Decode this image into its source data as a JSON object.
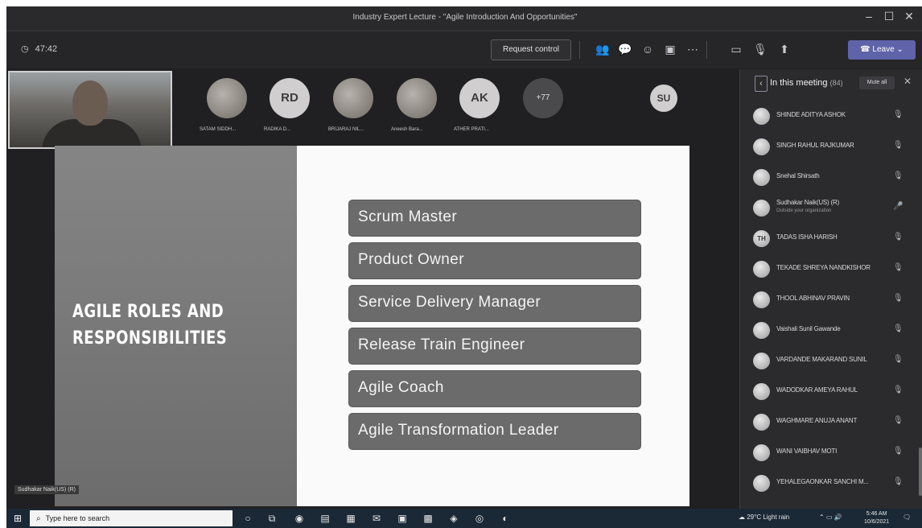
{
  "window": {
    "title": "Industry Expert Lecture - \"Agile Introduction And Opportunities\""
  },
  "toolbar": {
    "timer": "47:42",
    "request_control": "Request control",
    "leave": "Leave"
  },
  "video_strip": {
    "avatars": [
      {
        "initials": "",
        "name": "SATAM SIDDH..."
      },
      {
        "initials": "RD",
        "name": "RADIKA D..."
      },
      {
        "initials": "",
        "name": "BRIJARAJ NIL..."
      },
      {
        "initials": "",
        "name": "Aneesh Bara..."
      },
      {
        "initials": "AK",
        "name": "ATHER PRATI..."
      },
      {
        "initials": "+77",
        "name": ""
      },
      {
        "initials": "SU",
        "name": ""
      }
    ]
  },
  "slide": {
    "title_line1": "AGILE ROLES AND",
    "title_line2": "RESPONSIBILITIES",
    "roles": [
      "Scrum Master",
      "Product Owner",
      "Service Delivery Manager",
      "Release Train Engineer",
      "Agile Coach",
      "Agile Transformation Leader"
    ],
    "presenter_label": "Sudhakar Naik(US) (R)"
  },
  "panel": {
    "title": "In this meeting",
    "count": "(84)",
    "mute_all": "Mute all",
    "participants": [
      {
        "name": "SHINDE ADITYA ASHOK",
        "initials": "",
        "sub": ""
      },
      {
        "name": "SINGH RAHUL RAJKUMAR",
        "initials": "",
        "sub": ""
      },
      {
        "name": "Snehal Shirsath",
        "initials": "",
        "sub": ""
      },
      {
        "name": "Sudhakar Naik(US) (R)",
        "initials": "",
        "sub": "Outside your organization"
      },
      {
        "name": "TADAS ISHA HARISH",
        "initials": "TH",
        "sub": ""
      },
      {
        "name": "TEKADE SHREYA NANDKISHOR",
        "initials": "",
        "sub": ""
      },
      {
        "name": "THOOL ABHINAV PRAVIN",
        "initials": "",
        "sub": ""
      },
      {
        "name": "Vaishali Sunil Gawande",
        "initials": "",
        "sub": ""
      },
      {
        "name": "VARDANDE MAKARAND SUNIL",
        "initials": "",
        "sub": ""
      },
      {
        "name": "WADODKAR AMEYA RAHUL",
        "initials": "",
        "sub": ""
      },
      {
        "name": "WAGHMARE ANUJA ANANT",
        "initials": "",
        "sub": ""
      },
      {
        "name": "WANI VAIBHAV MOTI",
        "initials": "",
        "sub": ""
      },
      {
        "name": "YEHALEGAONKAR SANCHI M...",
        "initials": "",
        "sub": ""
      }
    ]
  },
  "taskbar": {
    "search_placeholder": "Type here to search",
    "weather": "29°C Light rain",
    "time": "5:46 AM",
    "date": "10/6/2021"
  }
}
